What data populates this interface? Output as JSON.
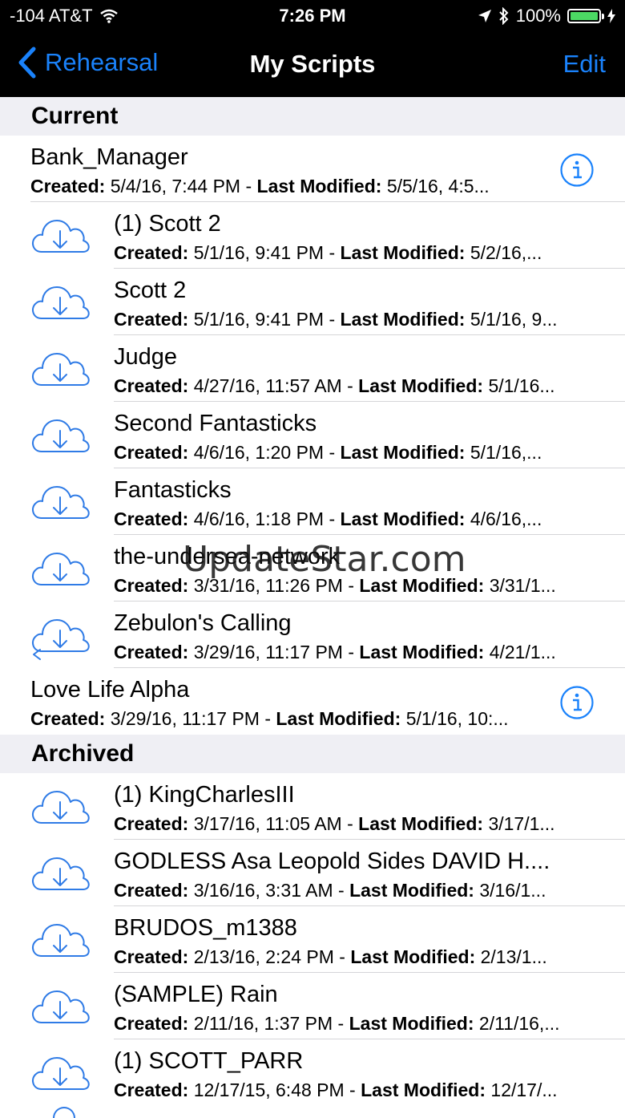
{
  "status": {
    "carrier": "-104 AT&T",
    "time": "7:26 PM",
    "battery": "100%"
  },
  "nav": {
    "back_label": "Rehearsal",
    "title": "My Scripts",
    "edit_label": "Edit"
  },
  "sections": {
    "current": "Current",
    "archived": "Archived"
  },
  "labels": {
    "created": "Created:",
    "last_modified": "Last Modified:"
  },
  "current": [
    {
      "title": "Bank_Manager",
      "created": "5/4/16, 7:44 PM",
      "modified": "5/5/16, 4:5..."
    },
    {
      "title": "(1) Scott 2",
      "created": "5/1/16, 9:41 PM",
      "modified": "5/2/16,..."
    },
    {
      "title": "Scott 2",
      "created": "5/1/16, 9:41 PM",
      "modified": "5/1/16, 9..."
    },
    {
      "title": "Judge",
      "created": "4/27/16, 11:57 AM",
      "modified": "5/1/16..."
    },
    {
      "title": "Second Fantasticks",
      "created": "4/6/16, 1:20 PM",
      "modified": "5/1/16,..."
    },
    {
      "title": "Fantasticks",
      "created": "4/6/16, 1:18 PM",
      "modified": "4/6/16,..."
    },
    {
      "title": "the-undersea-network",
      "created": "3/31/16, 11:26 PM",
      "modified": "3/31/1..."
    },
    {
      "title": "Zebulon's Calling",
      "created": "3/29/16, 11:17 PM",
      "modified": "4/21/1..."
    },
    {
      "title": "Love Life Alpha",
      "created": "3/29/16, 11:17 PM",
      "modified": "5/1/16, 10:..."
    }
  ],
  "archived": [
    {
      "title": "(1) KingCharlesIII",
      "created": "3/17/16, 11:05 AM",
      "modified": "3/17/1..."
    },
    {
      "title": "GODLESS Asa Leopold Sides DAVID H....",
      "created": "3/16/16, 3:31 AM",
      "modified": "3/16/1..."
    },
    {
      "title": "BRUDOS_m1388",
      "created": "2/13/16, 2:24 PM",
      "modified": "2/13/1..."
    },
    {
      "title": "(SAMPLE) Rain",
      "created": "2/11/16, 1:37 PM",
      "modified": "2/11/16,..."
    },
    {
      "title": "(1) SCOTT_PARR",
      "created": "12/17/15, 6:48 PM",
      "modified": "12/17/..."
    }
  ],
  "watermark": "UpdateStar.com",
  "colors": {
    "accent": "#1a82fb",
    "icon": "#2f7be6",
    "section_bg": "#efeff4",
    "bar_bg": "#000000",
    "battery": "#4cd964"
  }
}
